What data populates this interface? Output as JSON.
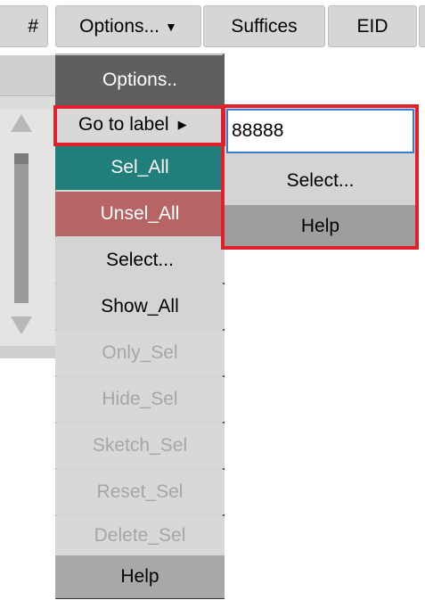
{
  "header": {
    "first_col_label": "#",
    "options_label": "Options...",
    "options_arrow": "▼",
    "suffices_label": "Suffices",
    "eid_label": "EID"
  },
  "menu": {
    "title": "Options..",
    "goto_label": "Go to label",
    "goto_arrow": "▶",
    "items": {
      "sel_all": "Sel_All",
      "unsel_all": "Unsel_All",
      "select": "Select...",
      "show_all": "Show_All",
      "only_sel": "Only_Sel",
      "hide_sel": "Hide_Sel",
      "sketch_sel": "Sketch_Sel",
      "reset_sel": "Reset_Sel",
      "delete_sel": "Delete_Sel",
      "help": "Help"
    }
  },
  "submenu": {
    "input_value": "88888",
    "select_label": "Select...",
    "help_label": "Help"
  },
  "colors": {
    "sel_all_bg": "#207f7a",
    "unsel_all_bg": "#b66464",
    "title_bg": "#5f5f5f",
    "highlight": "#e0202a",
    "input_border": "#3a7bd5"
  }
}
